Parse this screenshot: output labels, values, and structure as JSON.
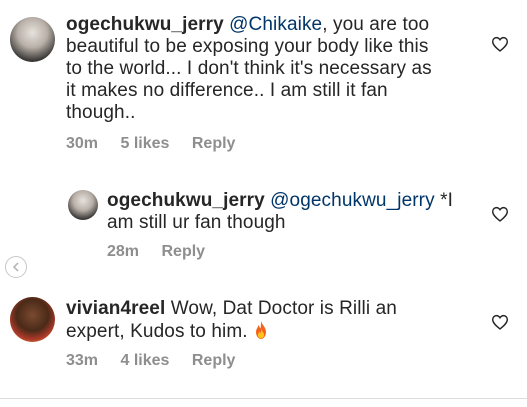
{
  "comments": [
    {
      "username": "ogechukwu_jerry",
      "mention": "@Chikaike",
      "text_line1_after": ", you are too",
      "text_line2": "beautiful to be exposing your body like this",
      "text_line3": "to the world... I don't think it's necessary as",
      "text_line4": "it makes no difference.. I am still it fan",
      "text_line5": "though..",
      "time": "30m",
      "likes": "5 likes",
      "reply_label": "Reply",
      "heart_icon": "heart-outline-icon"
    },
    {
      "username": "ogechukwu_jerry",
      "mention": "@ogechukwu_jerry",
      "text_line1_after": " *I",
      "text_line2": "am still ur fan though",
      "time": "28m",
      "reply_label": "Reply",
      "heart_icon": "heart-outline-icon"
    },
    {
      "username": "vivian4reel",
      "text_line1_after": " Wow, Dat Doctor is Rilli an",
      "text_line2": "expert, Kudos to him. ",
      "emoji": "fire-emoji",
      "time": "33m",
      "likes": "4 likes",
      "reply_label": "Reply",
      "heart_icon": "heart-outline-icon"
    }
  ],
  "colors": {
    "text": "#262626",
    "meta": "#8e8e8e",
    "mention": "#003569",
    "divider": "#dbdbdb"
  }
}
